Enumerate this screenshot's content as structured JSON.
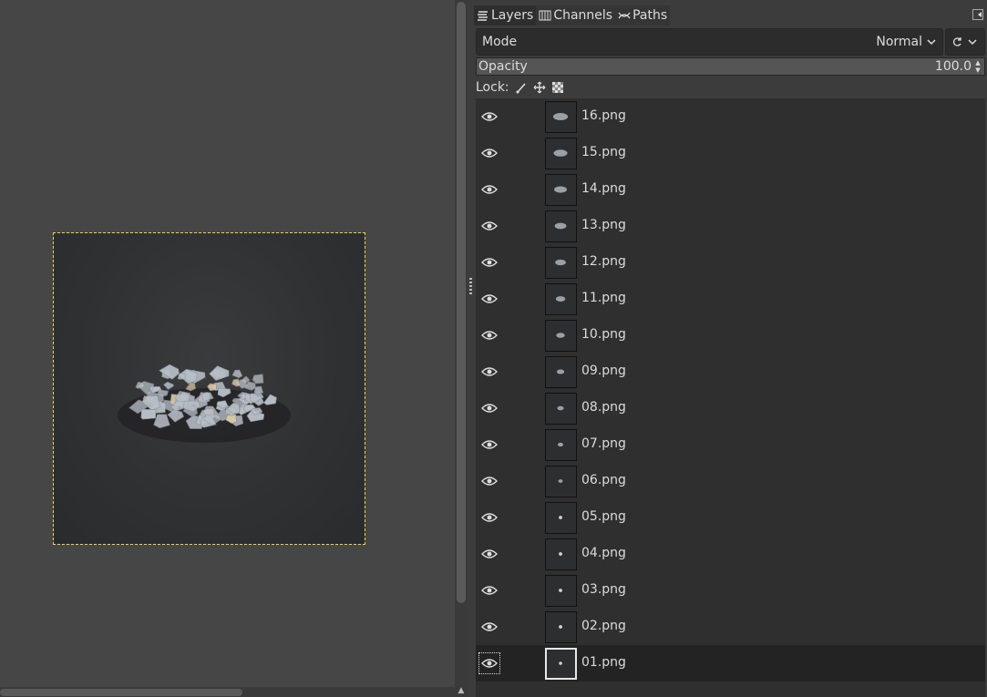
{
  "dock": {
    "tabs": [
      {
        "label": "Layers",
        "icon": "layers-icon",
        "active": true
      },
      {
        "label": "Channels",
        "icon": "channels-icon",
        "active": false
      },
      {
        "label": "Paths",
        "icon": "paths-icon",
        "active": false
      }
    ],
    "mode_label": "Mode",
    "mode_value": "Normal",
    "opacity_label": "Opacity",
    "opacity_value": "100.0",
    "lock_label": "Lock:"
  },
  "layers": [
    {
      "name": "16.png",
      "pile": 16
    },
    {
      "name": "15.png",
      "pile": 15
    },
    {
      "name": "14.png",
      "pile": 14
    },
    {
      "name": "13.png",
      "pile": 13
    },
    {
      "name": "12.png",
      "pile": 12
    },
    {
      "name": "11.png",
      "pile": 11
    },
    {
      "name": "10.png",
      "pile": 10
    },
    {
      "name": "09.png",
      "pile": 9
    },
    {
      "name": "08.png",
      "pile": 8
    },
    {
      "name": "07.png",
      "pile": 7
    },
    {
      "name": "06.png",
      "pile": 6
    },
    {
      "name": "05.png",
      "pile": 5
    },
    {
      "name": "04.png",
      "pile": 4
    },
    {
      "name": "03.png",
      "pile": 3
    },
    {
      "name": "02.png",
      "pile": 2
    },
    {
      "name": "01.png",
      "pile": 1,
      "selected": true
    }
  ],
  "colors": {
    "selection_marquee": "#e6d84a",
    "rubble": "#b9bfc8"
  }
}
